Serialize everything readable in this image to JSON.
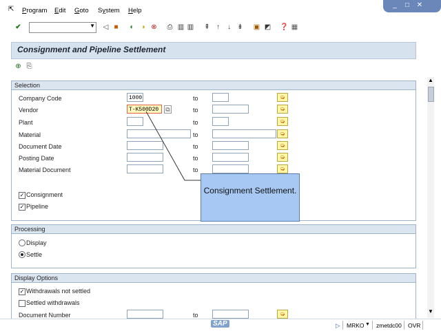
{
  "menu": {
    "items": [
      "Program",
      "Edit",
      "Goto",
      "System",
      "Help"
    ],
    "underline": [
      "P",
      "E",
      "G",
      "y",
      "H"
    ]
  },
  "window_controls": {
    "minimize": "_",
    "maximize": "□",
    "close": "✕"
  },
  "toolbar": {
    "command_field_value": ""
  },
  "title": "Consignment and Pipeline Settlement",
  "selection": {
    "header": "Selection",
    "to_label": "to",
    "rows": [
      {
        "label": "Company Code",
        "from": "1000",
        "to_value": ""
      },
      {
        "label": "Vendor",
        "from": "T-K500D20",
        "to_value": ""
      },
      {
        "label": "Plant",
        "from": "",
        "to_value": ""
      },
      {
        "label": "Material",
        "from": "",
        "to_value": ""
      },
      {
        "label": "Document Date",
        "from": "",
        "to_value": ""
      },
      {
        "label": "Posting Date",
        "from": "",
        "to_value": ""
      },
      {
        "label": "Material Document",
        "from": "",
        "to_value": ""
      }
    ],
    "checkboxes": [
      {
        "label": "Consignment",
        "checked": true
      },
      {
        "label": "Pipeline",
        "checked": true
      }
    ]
  },
  "processing": {
    "header": "Processing",
    "options": [
      {
        "label": "Display",
        "selected": false
      },
      {
        "label": "Settle",
        "selected": true
      }
    ]
  },
  "display_options": {
    "header": "Display Options",
    "checkboxes": [
      {
        "label": "Withdrawals not settled",
        "checked": true
      },
      {
        "label": "Settled withdrawals",
        "checked": false
      }
    ],
    "document_number_label": "Document Number",
    "to_label": "to"
  },
  "callout": {
    "text": "Consignment Settlement."
  },
  "status": {
    "system": "MRKO",
    "server": "zmetdc00",
    "mode": "OVR",
    "logo": "SAP"
  },
  "colors": {
    "title_bg": "#d7e2ef",
    "callout_bg": "#a7c8f2",
    "active_field": "#fff8bf"
  }
}
